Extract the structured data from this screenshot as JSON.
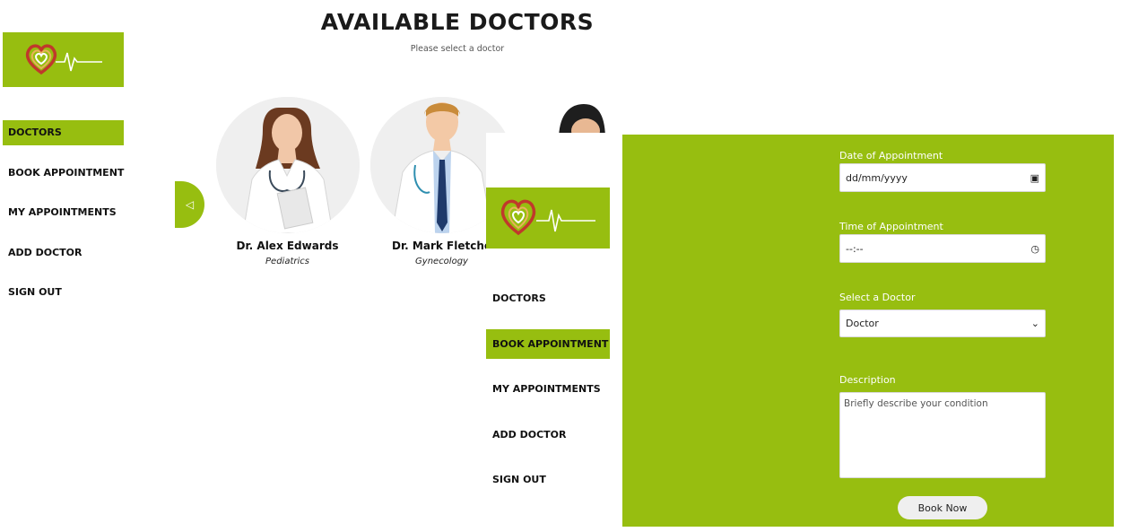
{
  "colors": {
    "accent": "#97be10",
    "text": "#111111"
  },
  "sidebar": {
    "logo_icon": "heart-pulse-logo",
    "items": [
      {
        "label": "DOCTORS",
        "active": true
      },
      {
        "label": "BOOK APPOINTMENT",
        "active": false
      },
      {
        "label": "MY APPOINTMENTS",
        "active": false
      },
      {
        "label": "ADD DOCTOR",
        "active": false
      },
      {
        "label": "SIGN OUT",
        "active": false
      }
    ]
  },
  "header": {
    "title": "AVAILABLE DOCTORS",
    "subtitle": "Please select a doctor"
  },
  "carousel": {
    "prev_icon": "chevron-left-icon",
    "doctors": [
      {
        "name": "Dr. Alex Edwards",
        "specialty": "Pediatrics"
      },
      {
        "name": "Dr. Mark Fletche",
        "specialty": "Gynecology"
      }
    ]
  },
  "sidebar2": {
    "logo_icon": "heart-pulse-logo",
    "items": [
      {
        "label": "DOCTORS",
        "active": false
      },
      {
        "label": "BOOK APPOINTMENT",
        "active": true
      },
      {
        "label": "MY APPOINTMENTS",
        "active": false
      },
      {
        "label": "ADD DOCTOR",
        "active": false
      },
      {
        "label": "SIGN OUT",
        "active": false
      }
    ]
  },
  "booking": {
    "date_label": "Date of Appointment",
    "date_value": "dd/mm/yyyy",
    "date_icon": "calendar-icon",
    "time_label": "Time of Appointment",
    "time_value": "--:--",
    "time_icon": "clock-icon",
    "doctor_label": "Select a Doctor",
    "doctor_value": "Doctor",
    "description_label": "Description",
    "description_placeholder": "Briefly describe your condition",
    "submit_label": "Book Now"
  }
}
